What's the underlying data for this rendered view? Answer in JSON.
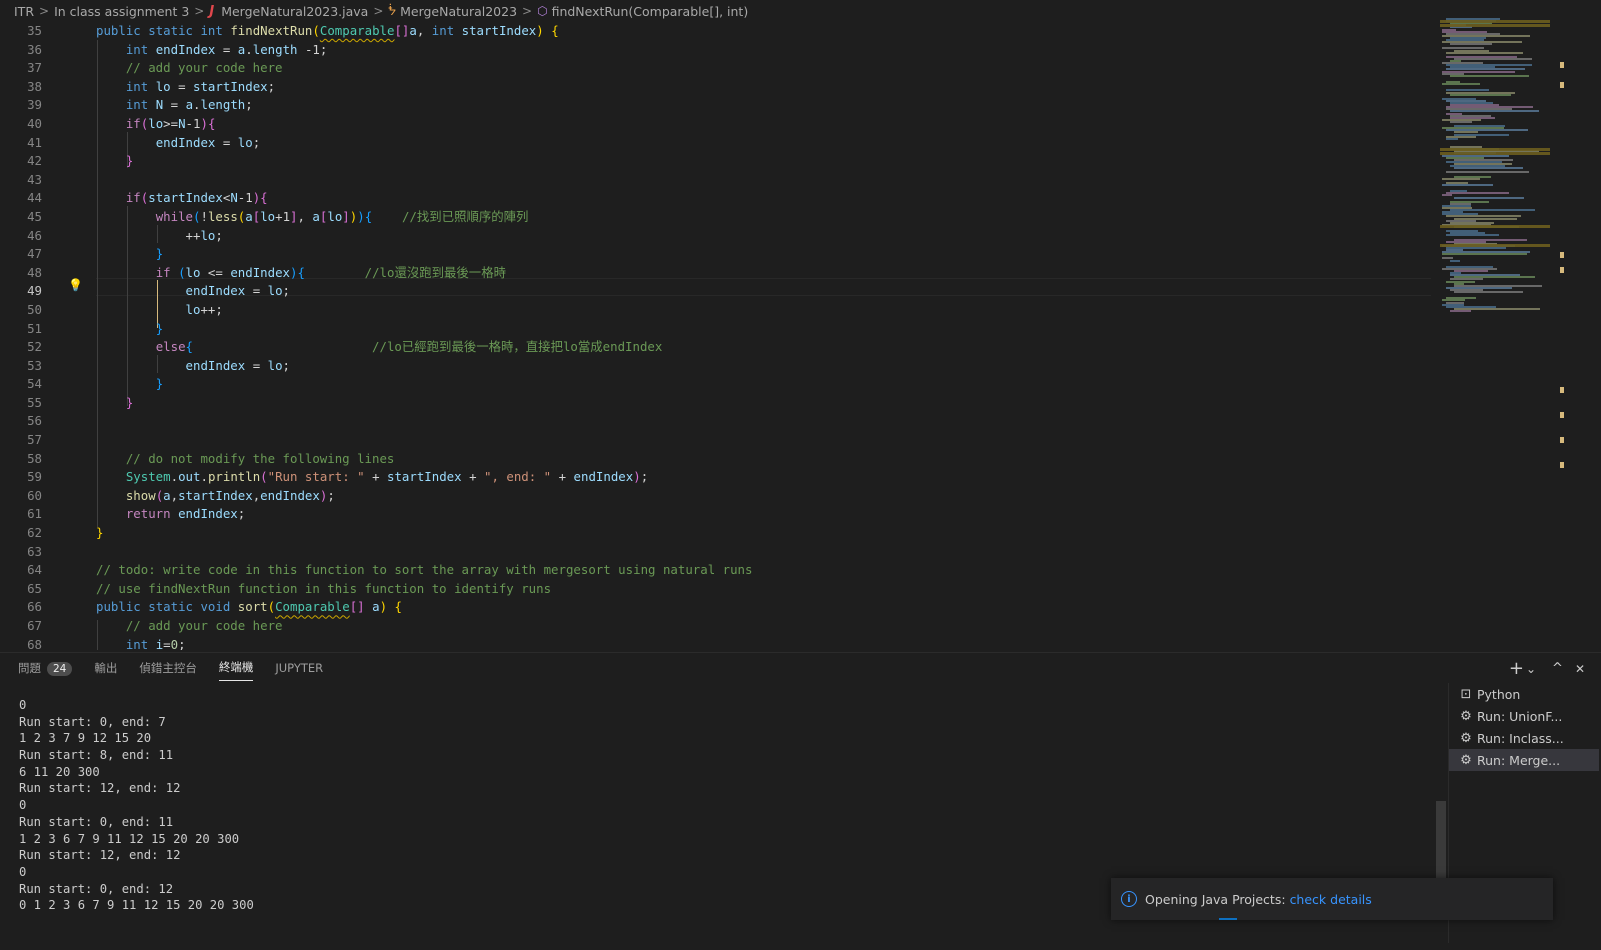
{
  "breadcrumb": {
    "items": [
      "ITR",
      "In class assignment 3",
      "MergeNatural2023.java",
      "MergeNatural2023",
      "findNextRun(Comparable[], int)"
    ],
    "separator": ">"
  },
  "editor": {
    "line_numbers": [
      "35",
      "36",
      "37",
      "38",
      "39",
      "40",
      "41",
      "42",
      "43",
      "44",
      "45",
      "46",
      "47",
      "48",
      "49",
      "50",
      "51",
      "52",
      "53",
      "54",
      "55",
      "56",
      "57",
      "58",
      "59",
      "60",
      "61",
      "62",
      "63",
      "64",
      "65",
      "66",
      "67",
      "68"
    ],
    "active_line": "49",
    "code": {
      "l35": [
        "public",
        "static",
        "int",
        "findNextRun",
        "Comparable",
        "a",
        "int",
        "startIndex"
      ],
      "l36": [
        "int",
        "endIndex",
        "=",
        "a",
        "length",
        "-1;"
      ],
      "l37": "// add your code here",
      "l38": [
        "int",
        "lo",
        "= ",
        "startIndex",
        ";"
      ],
      "l39": [
        "int",
        "N",
        "= ",
        "a",
        "length",
        ";"
      ],
      "l40": [
        "if",
        "lo",
        ">=",
        "N",
        "-1"
      ],
      "l41": [
        "endIndex",
        "= ",
        "lo",
        ";"
      ],
      "l44": [
        "if",
        "startIndex",
        "<",
        "N",
        "-1"
      ],
      "l45": [
        "while",
        "!",
        "less",
        "a",
        "lo",
        "+1",
        "a",
        "lo"
      ],
      "l45_comment": "//找到已照順序的陣列",
      "l46": [
        "++",
        "lo",
        ";"
      ],
      "l48": [
        "if",
        "lo",
        " <= ",
        "endIndex"
      ],
      "l48_comment": "//lo還沒跑到最後一格時",
      "l49": [
        "endIndex",
        "= ",
        "lo",
        ";"
      ],
      "l50": [
        "lo",
        "++;"
      ],
      "l52": "else",
      "l52_comment": "//lo已經跑到最後一格時，直接把lo當成endIndex",
      "l53": [
        "endIndex",
        "= ",
        "lo",
        ";"
      ],
      "l58": "// do not modify the following lines",
      "l59": [
        "System",
        "out",
        "println",
        "\"Run start: \"",
        "startIndex",
        "\", end: \"",
        "endIndex"
      ],
      "l60": [
        "show",
        "a",
        "startIndex",
        "endIndex"
      ],
      "l61": [
        "return",
        "endIndex",
        ";"
      ],
      "l64": "// todo: write code in this function to sort the array with mergesort using natural runs",
      "l65": "// use findNextRun function in this function to identify runs",
      "l66": [
        "public",
        "static",
        "void",
        "sort",
        "Comparable",
        "a"
      ],
      "l67": "// add your code here",
      "l68": [
        "int",
        "i",
        "=",
        "0",
        ";"
      ]
    }
  },
  "panel": {
    "tabs": [
      {
        "label": "問題",
        "badge": "24"
      },
      {
        "label": "輸出"
      },
      {
        "label": "偵錯主控台"
      },
      {
        "label": "終端機"
      },
      {
        "label": "JUPYTER"
      }
    ],
    "terminal_lines": [
      "0",
      "Run start: 0, end: 7",
      "1 2 3 7 9 12 15 20",
      "Run start: 8, end: 11",
      "6 11 20 300",
      "Run start: 12, end: 12",
      "0",
      "Run start: 0, end: 11",
      "1 2 3 6 7 9 11 12 15 20 20 300",
      "Run start: 12, end: 12",
      "0",
      "Run start: 0, end: 12",
      "0 1 2 3 6 7 9 11 12 15 20 20 300"
    ],
    "terminals": [
      {
        "label": "Python",
        "icon": "terminal-icon"
      },
      {
        "label": "Run: UnionF...",
        "icon": "debug-gear-icon"
      },
      {
        "label": "Run: Inclass...",
        "icon": "debug-gear-icon"
      },
      {
        "label": "Run: Merge...",
        "icon": "debug-gear-icon"
      }
    ],
    "actions": {
      "add": "+",
      "dropdown": "⌄",
      "maximize": "^",
      "close": "✕"
    }
  },
  "notification": {
    "text": "Opening Java Projects:",
    "link": "check details"
  },
  "colors": {
    "background": "#1e1e1e",
    "keyword": "#569cd6",
    "control": "#c586c0",
    "function": "#dcdcaa",
    "type": "#4ec9b0",
    "variable": "#9cdcfe",
    "comment": "#6a9955",
    "string": "#ce9178",
    "link": "#3794ff"
  }
}
